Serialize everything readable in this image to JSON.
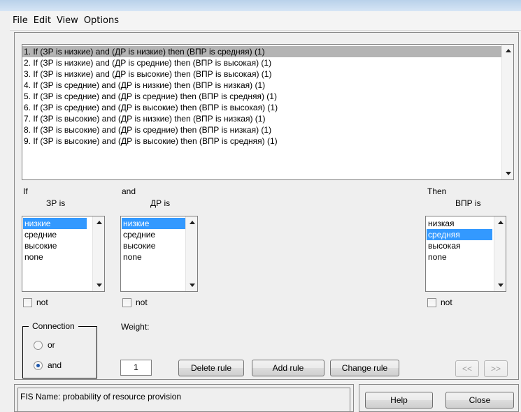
{
  "menu": [
    "File",
    "Edit",
    "View",
    "Options"
  ],
  "rules": [
    "1. If (ЗР is низкие) and (ДР is низкие) then (ВПР is средняя) (1)",
    "2. If (ЗР is низкие) and (ДР is средние) then (ВПР is высокая) (1)",
    "3. If (ЗР is низкие) and (ДР is высокие) then (ВПР is высокая) (1)",
    "4. If (ЗР is средние) and (ДР is низкие) then (ВПР is низкая) (1)",
    "5. If (ЗР is средние) and (ДР is средние) then (ВПР is средняя) (1)",
    "6. If (ЗР is средние) and (ДР is высокие) then (ВПР is высокая) (1)",
    "7. If (ЗР is высокие) and (ДР is низкие) then (ВПР is низкая) (1)",
    "8. If (ЗР is высокие) and (ДР is средние) then (ВПР is низкая) (1)",
    "9. If (ЗР is высокие) and (ДР is высокие) then (ВПР is средняя) (1)"
  ],
  "selected_rule_index": 0,
  "antecedent1": {
    "keyword": "If",
    "variable_label": "ЗР is",
    "options": [
      "низкие",
      "средние",
      "высокие",
      "none"
    ],
    "selected_index": 0,
    "not_label": "not",
    "not_checked": false
  },
  "antecedent2": {
    "keyword": "and",
    "variable_label": "ДР is",
    "options": [
      "низкие",
      "средние",
      "высокие",
      "none"
    ],
    "selected_index": 0,
    "not_label": "not",
    "not_checked": false
  },
  "consequent": {
    "keyword": "Then",
    "variable_label": "ВПР is",
    "options": [
      "низкая",
      "средняя",
      "высокая",
      "none"
    ],
    "selected_index": 1,
    "not_label": "not",
    "not_checked": false
  },
  "connection": {
    "legend": "Connection",
    "options": [
      "or",
      "and"
    ],
    "selected": "and"
  },
  "weight": {
    "label": "Weight:",
    "value": "1"
  },
  "buttons": {
    "delete_rule": "Delete rule",
    "add_rule": "Add rule",
    "change_rule": "Change rule",
    "prev": "<<",
    "next": ">>",
    "help": "Help",
    "close": "Close"
  },
  "status": "FIS Name: probability of resource provision",
  "colors": {
    "selection_blue": "#3399ff",
    "rule_selection_gray": "#b4b4b4",
    "radio_dot": "#1c56ad"
  }
}
